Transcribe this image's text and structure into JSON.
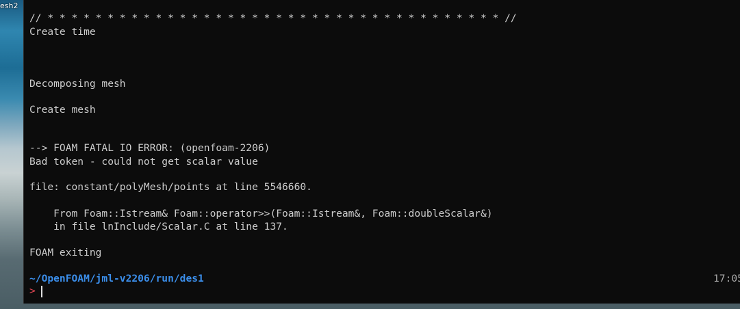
{
  "desktop": {
    "window_label": "esh2"
  },
  "terminal": {
    "lines": [
      "// * * * * * * * * * * * * * * * * * * * * * * * * * * * * * * * * * * * * * * //",
      "Create time",
      "Decomposing mesh",
      "Create mesh",
      "--> FOAM FATAL IO ERROR: (openfoam-2206)",
      "Bad token - could not get scalar value",
      "file: constant/polyMesh/points at line 5546660.",
      "    From Foam::Istream& Foam::operator>>(Foam::Istream&, Foam::doubleScalar&)",
      "    in file lnInclude/Scalar.C at line 137.",
      "FOAM exiting"
    ],
    "prompt": {
      "path": "~/OpenFOAM/jml-v2206/run/",
      "dir": "des1",
      "time": "17:05",
      "symbol": ">"
    }
  },
  "colors": {
    "terminal_bg": "#0c0c0c",
    "text": "#cccccc",
    "path": "#3b8eea",
    "prompt_symbol": "#e74856"
  }
}
